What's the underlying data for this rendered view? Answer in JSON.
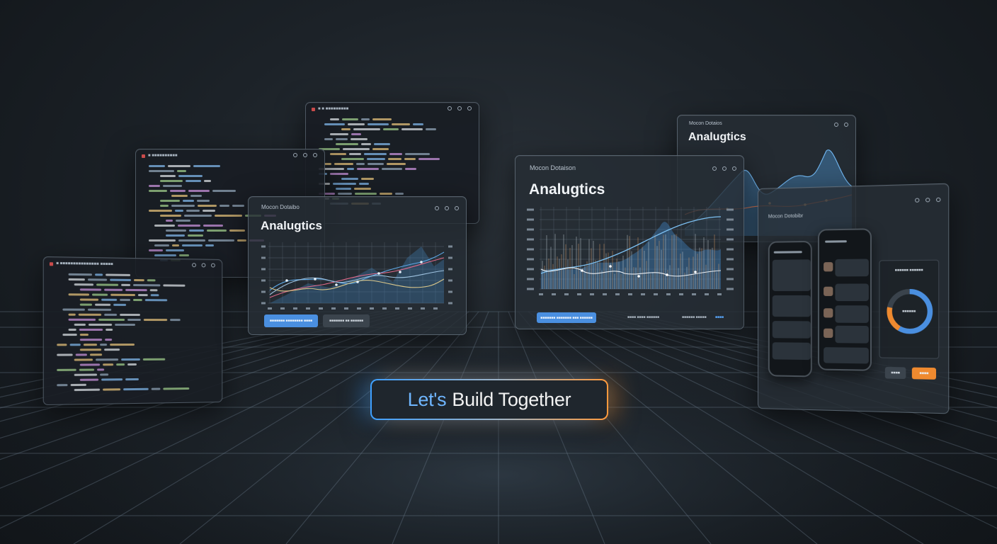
{
  "cta": {
    "part1": "Let's",
    "part2": "Build Together"
  },
  "colors": {
    "accent_blue": "#4a8fe0",
    "accent_orange": "#ef8a2f",
    "background": "#1c2228"
  },
  "code_window_top": {
    "title": "■ ■ ■■■■■■■■■"
  },
  "code_window_mid": {
    "title": "■ ■■■■■■■■■■"
  },
  "code_window_left": {
    "title": "■ ■■■■■■■■■■■■■■■ ■■■■■"
  },
  "analytics_small": {
    "subtitle": "Mocon Dotaibo",
    "title": "Analugtics",
    "primary_button": "■■■■■■■ ■■■■■■■■ ■■■■",
    "secondary_button": "■■■■■■■ ■■ ■■■■■■"
  },
  "analytics_main": {
    "subtitle": "Mocon Dotaison",
    "title": "Analugtics",
    "primary_button": "■■■■■■■ ■■■■■■■ ■■■ ■■■■■■",
    "footer_items": [
      "■■■■ ■■■■ ■■■■■■",
      "■■■■■■ ■■■■■",
      "■■■■"
    ]
  },
  "analytics_right": {
    "subtitle": "Mocon Dotaios",
    "title": "Analugtics"
  },
  "mobile_panel": {
    "title": "Mocon Dotobibr",
    "donut_header": "■■■■■■ ■■■■■■",
    "donut_center": "■■■■■■",
    "donut_value": 0.78,
    "left_button": "■■■■",
    "right_button": "■■■■"
  },
  "icons": [
    "gear-icon",
    "target-icon",
    "settings-icon",
    "close-icon"
  ]
}
